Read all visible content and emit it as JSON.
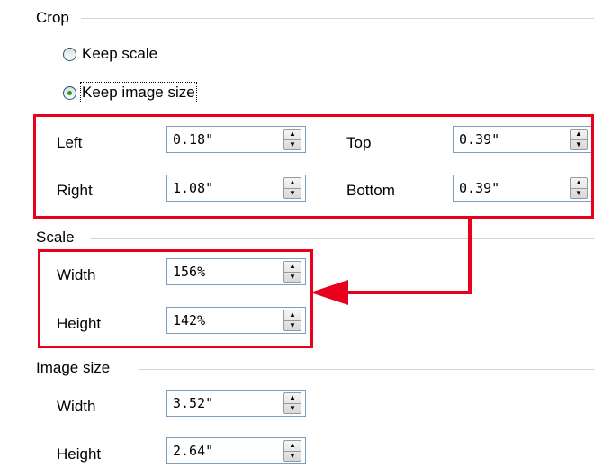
{
  "crop": {
    "title": "Crop",
    "keep_scale": "Keep scale",
    "keep_image_size": "Keep image size",
    "left_label": "Left",
    "right_label": "Right",
    "top_label": "Top",
    "bottom_label": "Bottom",
    "left_value": "0.18\"",
    "right_value": "1.08\"",
    "top_value": "0.39\"",
    "bottom_value": "0.39\""
  },
  "scale": {
    "title": "Scale",
    "width_label": "Width",
    "height_label": "Height",
    "width_value": "156%",
    "height_value": "142%"
  },
  "image_size": {
    "title": "Image size",
    "width_label": "Width",
    "height_label": "Height",
    "width_value": "3.52\"",
    "height_value": "2.64\""
  },
  "highlight_color": "#e8001c"
}
